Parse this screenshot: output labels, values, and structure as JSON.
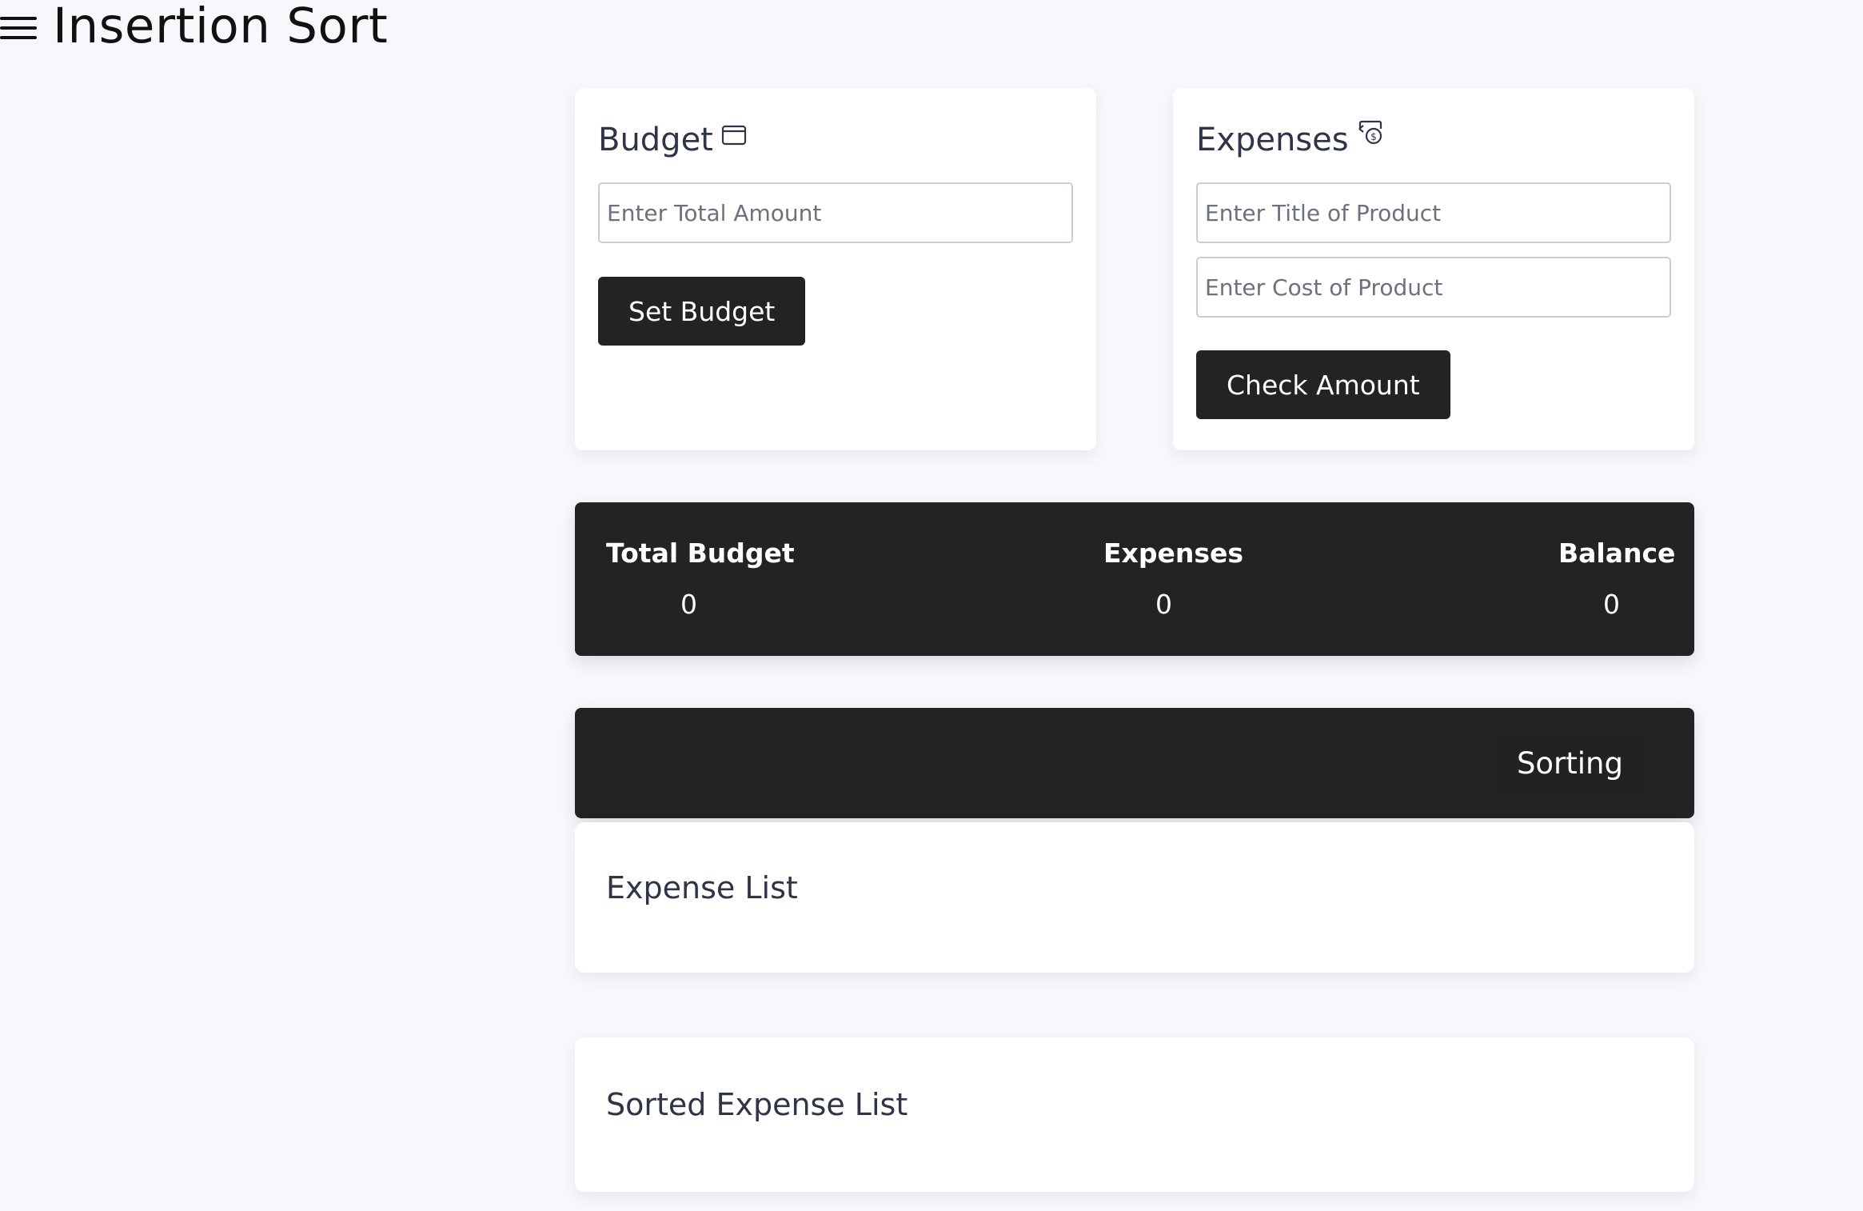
{
  "header": {
    "title": "Insertion Sort",
    "menu_icon": "hamburger-menu-icon"
  },
  "budget": {
    "title": "Budget",
    "icon": "wallet-icon",
    "amount_placeholder": "Enter Total Amount",
    "amount_value": "",
    "button_label": "Set Budget"
  },
  "expenses": {
    "title": "Expenses",
    "icon": "money-icon",
    "title_placeholder": "Enter Title of Product",
    "title_value": "",
    "cost_placeholder": "Enter Cost of Product",
    "cost_value": "",
    "button_label": "Check Amount"
  },
  "summary": {
    "total_budget_label": "Total Budget",
    "total_budget_value": "0",
    "expenses_label": "Expenses",
    "expenses_value": "0",
    "balance_label": "Balance",
    "balance_value": "0"
  },
  "sorting": {
    "button_label": "Sorting"
  },
  "lists": {
    "expense_list_title": "Expense List",
    "sorted_list_title": "Sorted Expense List"
  },
  "colors": {
    "background": "#f7f8fc",
    "card": "#ffffff",
    "dark": "#222325",
    "text": "#2f3446"
  }
}
